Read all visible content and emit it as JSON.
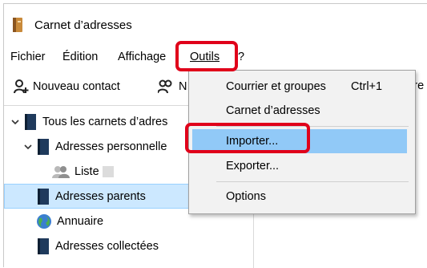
{
  "window": {
    "title": "Carnet d’adresses",
    "icon": "address-book-icon"
  },
  "menubar": {
    "items": [
      {
        "label": "Fichier"
      },
      {
        "label": "Édition"
      },
      {
        "label": "Affichage"
      },
      {
        "label": "Outils"
      },
      {
        "label": "?"
      }
    ]
  },
  "toolbar": {
    "new_contact": "Nouveau contact",
    "new_list_partial": "N",
    "write_partial": "crire"
  },
  "tree": {
    "items": [
      {
        "label": "Tous les carnets d’adres"
      },
      {
        "label": "Adresses personnelle"
      },
      {
        "label": "Liste"
      },
      {
        "label": "Adresses parents"
      },
      {
        "label": "Annuaire"
      },
      {
        "label": "Adresses collectées"
      }
    ]
  },
  "outils_menu": {
    "items": [
      {
        "label": "Courrier et groupes",
        "shortcut": "Ctrl+1"
      },
      {
        "label": "Carnet d’adresses"
      },
      {
        "label": "Importer..."
      },
      {
        "label": "Exporter..."
      },
      {
        "label": "Options"
      }
    ]
  },
  "colors": {
    "highlight": "#91c9f7",
    "selection": "#cce8ff",
    "callout": "#e0001a"
  }
}
